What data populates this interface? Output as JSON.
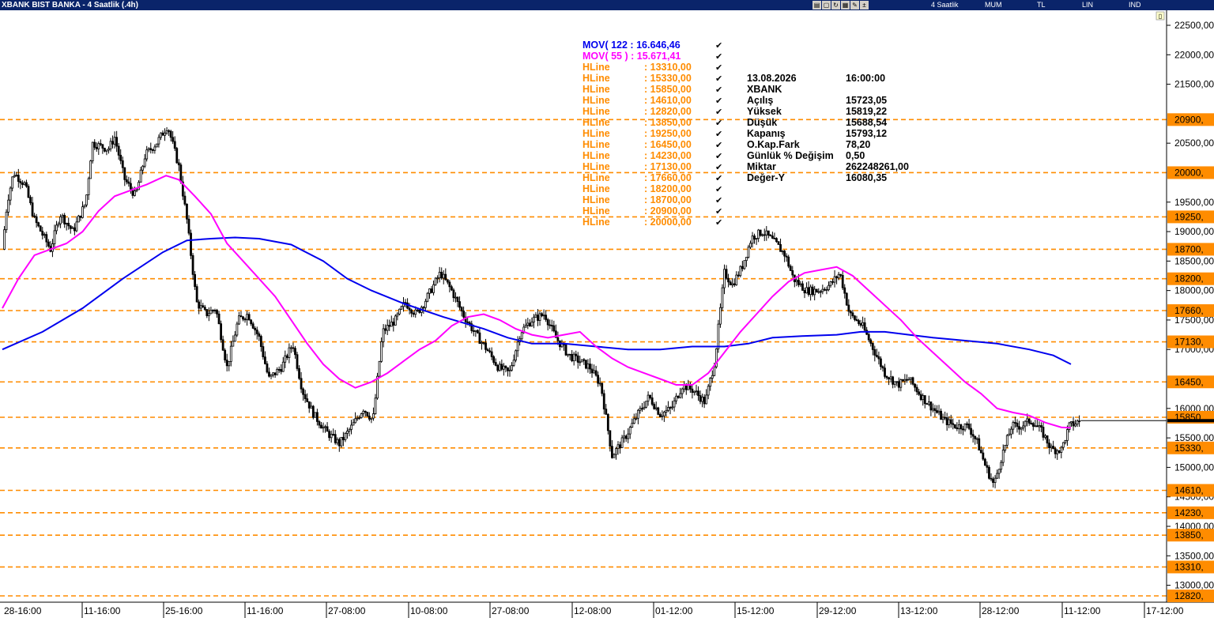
{
  "window": {
    "title": "XBANK BIST BANKA - 4 Saatlik (.4h)",
    "toolbar": {
      "period": "4 Saatlik",
      "candle_type": "MUM",
      "currency": "TL",
      "scale": "LIN",
      "indicator": "IND"
    }
  },
  "colors": {
    "mov122": "#0000ee",
    "mov55": "#ff00ff",
    "hline": "#ff8c00",
    "candle": "#000000",
    "background": "#ffffff"
  },
  "legend": {
    "mov": [
      {
        "label": "MOV( 122 : 16.646,46",
        "color": "#0000ee"
      },
      {
        "label": "MOV( 55 ) : 15.671,41",
        "color": "#ff00ff"
      }
    ],
    "hlines": [
      {
        "name": "HLine",
        "value": ": 13310,00"
      },
      {
        "name": "HLine",
        "value": ": 15330,00"
      },
      {
        "name": "HLine",
        "value": ": 15850,00"
      },
      {
        "name": "HLine",
        "value": ": 14610,00"
      },
      {
        "name": "HLine",
        "value": ": 12820,00"
      },
      {
        "name": "HLine",
        "value": ": 13850,00"
      },
      {
        "name": "HLine",
        "value": ": 19250,00"
      },
      {
        "name": "HLine",
        "value": ": 16450,00"
      },
      {
        "name": "HLine",
        "value": ": 14230,00"
      },
      {
        "name": "HLine",
        "value": ": 17130,00"
      },
      {
        "name": "HLine",
        "value": ": 17660,00"
      },
      {
        "name": "HLine",
        "value": ": 18200,00"
      },
      {
        "name": "HLine",
        "value": ": 18700,00"
      },
      {
        "name": "HLine",
        "value": ": 20900,00"
      },
      {
        "name": "HLine",
        "value": ": 20000,00"
      }
    ],
    "check": "✔"
  },
  "info_panel": {
    "rows": [
      {
        "label": "13.08.2026",
        "value": "16:00:00"
      },
      {
        "label": "XBANK",
        "value": ""
      },
      {
        "label": "Açılış",
        "value": "15723,05"
      },
      {
        "label": "Yüksek",
        "value": "15819,22"
      },
      {
        "label": "Düşük",
        "value": "15688,54"
      },
      {
        "label": "Kapanış",
        "value": "15793,12"
      },
      {
        "label": "O.Kap.Fark",
        "value": "78,20"
      },
      {
        "label": "Günlük % Değişim",
        "value": "0,50"
      },
      {
        "label": "Miktar",
        "value": "262248261,00"
      },
      {
        "label": "Değer-Y",
        "value": "16080,35"
      }
    ]
  },
  "chart_data": {
    "type": "candlestick",
    "title": "XBANK BIST BANKA - 4 Saatlik (.4h)",
    "ylim": [
      12700,
      22700
    ],
    "y_ticks": [
      {
        "value": 22500,
        "label": "22500,00"
      },
      {
        "value": 22000,
        "label": "22000,00"
      },
      {
        "value": 21500,
        "label": "21500,00"
      },
      {
        "value": 20500,
        "label": "20500,00"
      },
      {
        "value": 19500,
        "label": "19500,00"
      },
      {
        "value": 19000,
        "label": "19000,00"
      },
      {
        "value": 18500,
        "label": "18500,00"
      },
      {
        "value": 18000,
        "label": "18000,00"
      },
      {
        "value": 17500,
        "label": "17500,00"
      },
      {
        "value": 17000,
        "label": "17000,00"
      },
      {
        "value": 16000,
        "label": "16000,00"
      },
      {
        "value": 15500,
        "label": "15500,00"
      },
      {
        "value": 15000,
        "label": "15000,00"
      },
      {
        "value": 14500,
        "label": "14500,00"
      },
      {
        "value": 14000,
        "label": "14000,00"
      },
      {
        "value": 13500,
        "label": "13500,00"
      },
      {
        "value": 13000,
        "label": "13000,00"
      }
    ],
    "x_ticks": [
      "28-16:00",
      "11-16:00",
      "25-16:00",
      "11-16:00",
      "27-08:00",
      "10-08:00",
      "27-08:00",
      "12-08:00",
      "01-12:00",
      "15-12:00",
      "29-12:00",
      "13-12:00",
      "28-12:00",
      "11-12:00",
      "17-12:00"
    ],
    "hlines": [
      {
        "value": 20900,
        "label": "20900,"
      },
      {
        "value": 20000,
        "label": "20000,"
      },
      {
        "value": 19250,
        "label": "19250,"
      },
      {
        "value": 18700,
        "label": "18700,"
      },
      {
        "value": 18200,
        "label": "18200,"
      },
      {
        "value": 17660,
        "label": "17660,"
      },
      {
        "value": 17130,
        "label": "17130,"
      },
      {
        "value": 16450,
        "label": "16450,"
      },
      {
        "value": 15850,
        "label": "15850,"
      },
      {
        "value": 15330,
        "label": "15330,"
      },
      {
        "value": 14610,
        "label": "14610,"
      },
      {
        "value": 14230,
        "label": "14230,"
      },
      {
        "value": 13850,
        "label": "13850,"
      },
      {
        "value": 13310,
        "label": "13310,"
      },
      {
        "value": 12820,
        "label": "12820,"
      }
    ],
    "last_price": 15793.12,
    "close_path": [
      [
        0,
        18700
      ],
      [
        0.3,
        19500
      ],
      [
        0.7,
        20000
      ],
      [
        1.4,
        19800
      ],
      [
        2,
        19200
      ],
      [
        2.4,
        19000
      ],
      [
        3,
        18700
      ],
      [
        3.6,
        19300
      ],
      [
        4.4,
        19000
      ],
      [
        5.2,
        19500
      ],
      [
        5.6,
        20500
      ],
      [
        6.6,
        20400
      ],
      [
        7,
        20600
      ],
      [
        7.6,
        19900
      ],
      [
        8.3,
        19600
      ],
      [
        8.9,
        20300
      ],
      [
        9.6,
        20500
      ],
      [
        10.3,
        20800
      ],
      [
        11,
        20100
      ],
      [
        11.5,
        19200
      ],
      [
        12.1,
        17800
      ],
      [
        12.7,
        17600
      ],
      [
        13.3,
        17700
      ],
      [
        14,
        16700
      ],
      [
        14.7,
        17500
      ],
      [
        15.3,
        17600
      ],
      [
        16,
        17200
      ],
      [
        16.6,
        16500
      ],
      [
        17.4,
        16700
      ],
      [
        18.1,
        17100
      ],
      [
        18.7,
        16300
      ],
      [
        19.4,
        15900
      ],
      [
        20.2,
        15600
      ],
      [
        21,
        15400
      ],
      [
        21.8,
        15700
      ],
      [
        22.5,
        16000
      ],
      [
        23.1,
        15800
      ],
      [
        23.7,
        17300
      ],
      [
        24.5,
        17500
      ],
      [
        25.1,
        17800
      ],
      [
        25.8,
        17600
      ],
      [
        26.3,
        17800
      ],
      [
        27.3,
        18300
      ],
      [
        28,
        18000
      ],
      [
        28.7,
        17600
      ],
      [
        29.4,
        17300
      ],
      [
        30.2,
        17000
      ],
      [
        30.9,
        16700
      ],
      [
        31.6,
        16600
      ],
      [
        32.3,
        17300
      ],
      [
        33,
        17500
      ],
      [
        33.8,
        17600
      ],
      [
        34.5,
        17200
      ],
      [
        35.3,
        16900
      ],
      [
        36,
        16800
      ],
      [
        36.6,
        16700
      ],
      [
        37.3,
        16400
      ],
      [
        38,
        15200
      ],
      [
        38.8,
        15500
      ],
      [
        39.6,
        15900
      ],
      [
        40.3,
        16200
      ],
      [
        41,
        15900
      ],
      [
        41.7,
        16000
      ],
      [
        42.4,
        16400
      ],
      [
        43.1,
        16300
      ],
      [
        43.8,
        16100
      ],
      [
        44.4,
        16800
      ],
      [
        45,
        18300
      ],
      [
        45.5,
        18100
      ],
      [
        46.1,
        18400
      ],
      [
        46.7,
        18900
      ],
      [
        47.4,
        19000
      ],
      [
        48.2,
        18800
      ],
      [
        48.8,
        18600
      ],
      [
        49.3,
        18200
      ],
      [
        50.1,
        18000
      ],
      [
        50.9,
        18000
      ],
      [
        51.6,
        18100
      ],
      [
        52.2,
        18300
      ],
      [
        52.8,
        17600
      ],
      [
        53.6,
        17400
      ],
      [
        54.3,
        17000
      ],
      [
        55,
        16600
      ],
      [
        55.8,
        16400
      ],
      [
        56.5,
        16500
      ],
      [
        57.3,
        16200
      ],
      [
        58,
        16000
      ],
      [
        58.7,
        15800
      ],
      [
        59.4,
        15700
      ],
      [
        60.2,
        15700
      ],
      [
        60.8,
        15400
      ],
      [
        61.3,
        15000
      ],
      [
        61.8,
        14700
      ],
      [
        62.3,
        15200
      ],
      [
        62.9,
        15700
      ],
      [
        63.5,
        15700
      ],
      [
        64.1,
        15800
      ],
      [
        64.8,
        15600
      ],
      [
        65.4,
        15300
      ],
      [
        66,
        15300
      ],
      [
        66.5,
        15700
      ],
      [
        67.2,
        15793
      ]
    ],
    "mov122_path": [
      [
        0,
        17000
      ],
      [
        2.5,
        17300
      ],
      [
        5,
        17700
      ],
      [
        7.5,
        18200
      ],
      [
        10,
        18650
      ],
      [
        11.5,
        18850
      ],
      [
        13,
        18880
      ],
      [
        14.5,
        18900
      ],
      [
        16,
        18880
      ],
      [
        18,
        18780
      ],
      [
        20,
        18500
      ],
      [
        21.5,
        18200
      ],
      [
        23,
        18000
      ],
      [
        25,
        17780
      ],
      [
        27.5,
        17550
      ],
      [
        30,
        17350
      ],
      [
        31.5,
        17200
      ],
      [
        33,
        17100
      ],
      [
        35,
        17100
      ],
      [
        37,
        17050
      ],
      [
        39,
        17000
      ],
      [
        41,
        17000
      ],
      [
        43,
        17050
      ],
      [
        45,
        17050
      ],
      [
        46.5,
        17100
      ],
      [
        48,
        17200
      ],
      [
        50,
        17230
      ],
      [
        52,
        17250
      ],
      [
        53.5,
        17300
      ],
      [
        55,
        17300
      ],
      [
        56.5,
        17250
      ],
      [
        58,
        17200
      ],
      [
        60,
        17150
      ],
      [
        62,
        17100
      ],
      [
        64,
        17000
      ],
      [
        65.5,
        16900
      ],
      [
        66.6,
        16750
      ]
    ],
    "mov55_path": [
      [
        0,
        17700
      ],
      [
        1,
        18200
      ],
      [
        2,
        18600
      ],
      [
        3,
        18700
      ],
      [
        4,
        18800
      ],
      [
        5,
        19000
      ],
      [
        6,
        19350
      ],
      [
        7,
        19600
      ],
      [
        8,
        19700
      ],
      [
        9,
        19800
      ],
      [
        10.2,
        19950
      ],
      [
        11,
        19880
      ],
      [
        12,
        19600
      ],
      [
        13,
        19300
      ],
      [
        14,
        18800
      ],
      [
        15,
        18500
      ],
      [
        16,
        18200
      ],
      [
        17,
        17900
      ],
      [
        18,
        17500
      ],
      [
        19,
        17100
      ],
      [
        20,
        16750
      ],
      [
        21,
        16500
      ],
      [
        22,
        16350
      ],
      [
        23,
        16450
      ],
      [
        24,
        16600
      ],
      [
        25,
        16800
      ],
      [
        26,
        17000
      ],
      [
        27,
        17150
      ],
      [
        28,
        17400
      ],
      [
        29,
        17550
      ],
      [
        30,
        17600
      ],
      [
        31,
        17500
      ],
      [
        32,
        17350
      ],
      [
        33,
        17250
      ],
      [
        34,
        17200
      ],
      [
        35,
        17250
      ],
      [
        36,
        17300
      ],
      [
        37,
        17050
      ],
      [
        38,
        16850
      ],
      [
        39,
        16700
      ],
      [
        40,
        16600
      ],
      [
        41,
        16500
      ],
      [
        42,
        16400
      ],
      [
        43,
        16400
      ],
      [
        44,
        16600
      ],
      [
        45,
        16950
      ],
      [
        46,
        17300
      ],
      [
        47,
        17600
      ],
      [
        48,
        17900
      ],
      [
        49,
        18150
      ],
      [
        50,
        18300
      ],
      [
        51,
        18350
      ],
      [
        52,
        18400
      ],
      [
        53,
        18250
      ],
      [
        54,
        18000
      ],
      [
        55,
        17750
      ],
      [
        56,
        17500
      ],
      [
        57,
        17200
      ],
      [
        58,
        16950
      ],
      [
        59,
        16700
      ],
      [
        60,
        16450
      ],
      [
        61,
        16250
      ],
      [
        62,
        16000
      ],
      [
        63,
        15930
      ],
      [
        64,
        15880
      ],
      [
        65,
        15760
      ],
      [
        66,
        15680
      ],
      [
        66.6,
        15671
      ]
    ]
  }
}
